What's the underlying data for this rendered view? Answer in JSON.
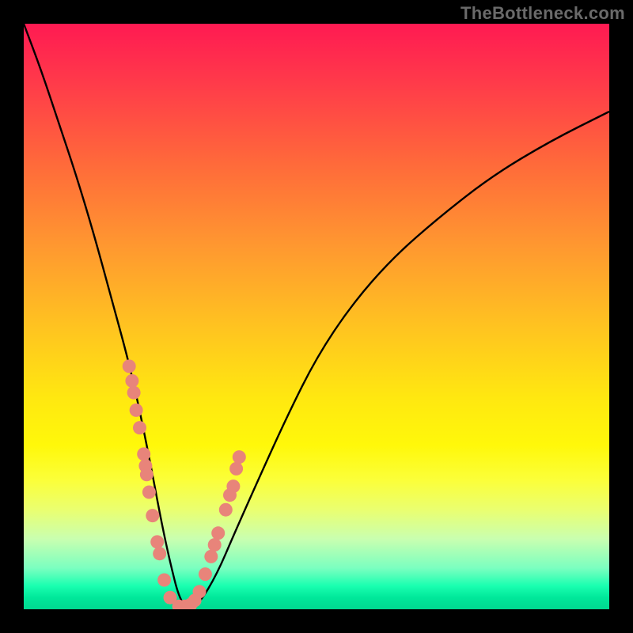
{
  "watermark": "TheBottleneck.com",
  "colors": {
    "bg": "#000000",
    "gradient_top": "#ff1a52",
    "gradient_bottom": "#00d890",
    "curve": "#000000",
    "dots": "#e8847a"
  },
  "chart_data": {
    "type": "line",
    "title": "",
    "xlabel": "",
    "ylabel": "",
    "xlim": [
      0,
      100
    ],
    "ylim": [
      0,
      100
    ],
    "series": [
      {
        "name": "bottleneck-curve",
        "x": [
          0,
          3,
          6,
          9,
          12,
          15,
          18,
          20,
          22,
          23.5,
          25,
          26.5,
          28,
          30,
          33,
          36,
          40,
          45,
          50,
          56,
          63,
          71,
          80,
          90,
          100
        ],
        "y": [
          100,
          92,
          83,
          74,
          64,
          53,
          42,
          33,
          23,
          15,
          8,
          2,
          0,
          1,
          6,
          13,
          22,
          33,
          43,
          52,
          60,
          67,
          74,
          80,
          85
        ]
      }
    ],
    "dots": {
      "name": "data-points",
      "note": "salmon-colored markers near the curve minimum, values as (x, y) in 0-100 range",
      "points": [
        [
          18.0,
          41.5
        ],
        [
          18.5,
          39.0
        ],
        [
          18.8,
          37.0
        ],
        [
          19.2,
          34.0
        ],
        [
          19.8,
          31.0
        ],
        [
          20.5,
          26.5
        ],
        [
          20.8,
          24.5
        ],
        [
          21.0,
          23.0
        ],
        [
          21.4,
          20.0
        ],
        [
          22.0,
          16.0
        ],
        [
          22.8,
          11.5
        ],
        [
          23.2,
          9.5
        ],
        [
          24.0,
          5.0
        ],
        [
          25.0,
          2.0
        ],
        [
          26.5,
          0.5
        ],
        [
          27.5,
          0.5
        ],
        [
          28.5,
          0.8
        ],
        [
          29.2,
          1.5
        ],
        [
          30.0,
          3.0
        ],
        [
          31.0,
          6.0
        ],
        [
          32.0,
          9.0
        ],
        [
          32.6,
          11.0
        ],
        [
          33.2,
          13.0
        ],
        [
          34.5,
          17.0
        ],
        [
          35.2,
          19.5
        ],
        [
          35.8,
          21.0
        ],
        [
          36.3,
          24.0
        ],
        [
          36.8,
          26.0
        ]
      ]
    }
  }
}
